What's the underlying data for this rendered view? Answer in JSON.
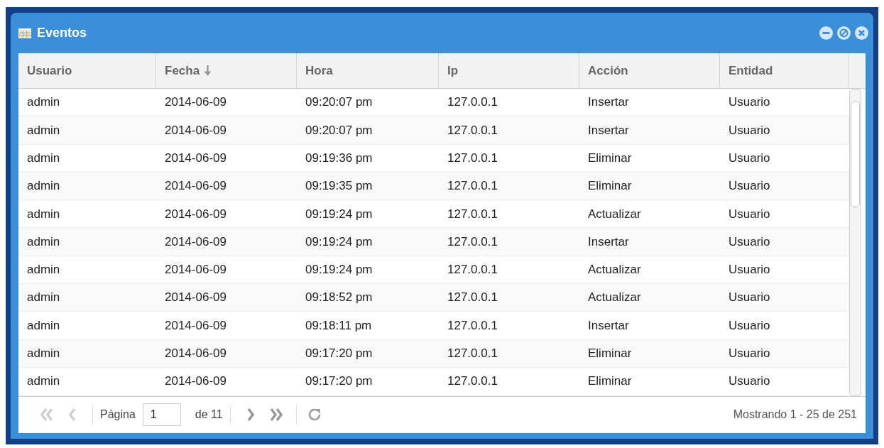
{
  "window": {
    "title": "Eventos"
  },
  "table": {
    "columns": [
      {
        "label": "Usuario",
        "sorted": false
      },
      {
        "label": "Fecha",
        "sorted": true
      },
      {
        "label": "Hora",
        "sorted": false
      },
      {
        "label": "Ip",
        "sorted": false
      },
      {
        "label": "Acción",
        "sorted": false
      },
      {
        "label": "Entidad",
        "sorted": false
      }
    ],
    "rows": [
      [
        "admin",
        "2014-06-09",
        "09:20:07 pm",
        "127.0.0.1",
        "Insertar",
        "Usuario"
      ],
      [
        "admin",
        "2014-06-09",
        "09:20:07 pm",
        "127.0.0.1",
        "Insertar",
        "Usuario"
      ],
      [
        "admin",
        "2014-06-09",
        "09:19:36 pm",
        "127.0.0.1",
        "Eliminar",
        "Usuario"
      ],
      [
        "admin",
        "2014-06-09",
        "09:19:35 pm",
        "127.0.0.1",
        "Eliminar",
        "Usuario"
      ],
      [
        "admin",
        "2014-06-09",
        "09:19:24 pm",
        "127.0.0.1",
        "Actualizar",
        "Usuario"
      ],
      [
        "admin",
        "2014-06-09",
        "09:19:24 pm",
        "127.0.0.1",
        "Insertar",
        "Usuario"
      ],
      [
        "admin",
        "2014-06-09",
        "09:19:24 pm",
        "127.0.0.1",
        "Actualizar",
        "Usuario"
      ],
      [
        "admin",
        "2014-06-09",
        "09:18:52 pm",
        "127.0.0.1",
        "Actualizar",
        "Usuario"
      ],
      [
        "admin",
        "2014-06-09",
        "09:18:11 pm",
        "127.0.0.1",
        "Insertar",
        "Usuario"
      ],
      [
        "admin",
        "2014-06-09",
        "09:17:20 pm",
        "127.0.0.1",
        "Eliminar",
        "Usuario"
      ],
      [
        "admin",
        "2014-06-09",
        "09:17:20 pm",
        "127.0.0.1",
        "Eliminar",
        "Usuario"
      ]
    ]
  },
  "pager": {
    "page_label": "Página",
    "page": "1",
    "of_label": "de 11",
    "first_disabled": true,
    "prev_disabled": true,
    "next_disabled": false,
    "last_disabled": false,
    "summary": "Mostrando 1 - 25 de 251"
  }
}
